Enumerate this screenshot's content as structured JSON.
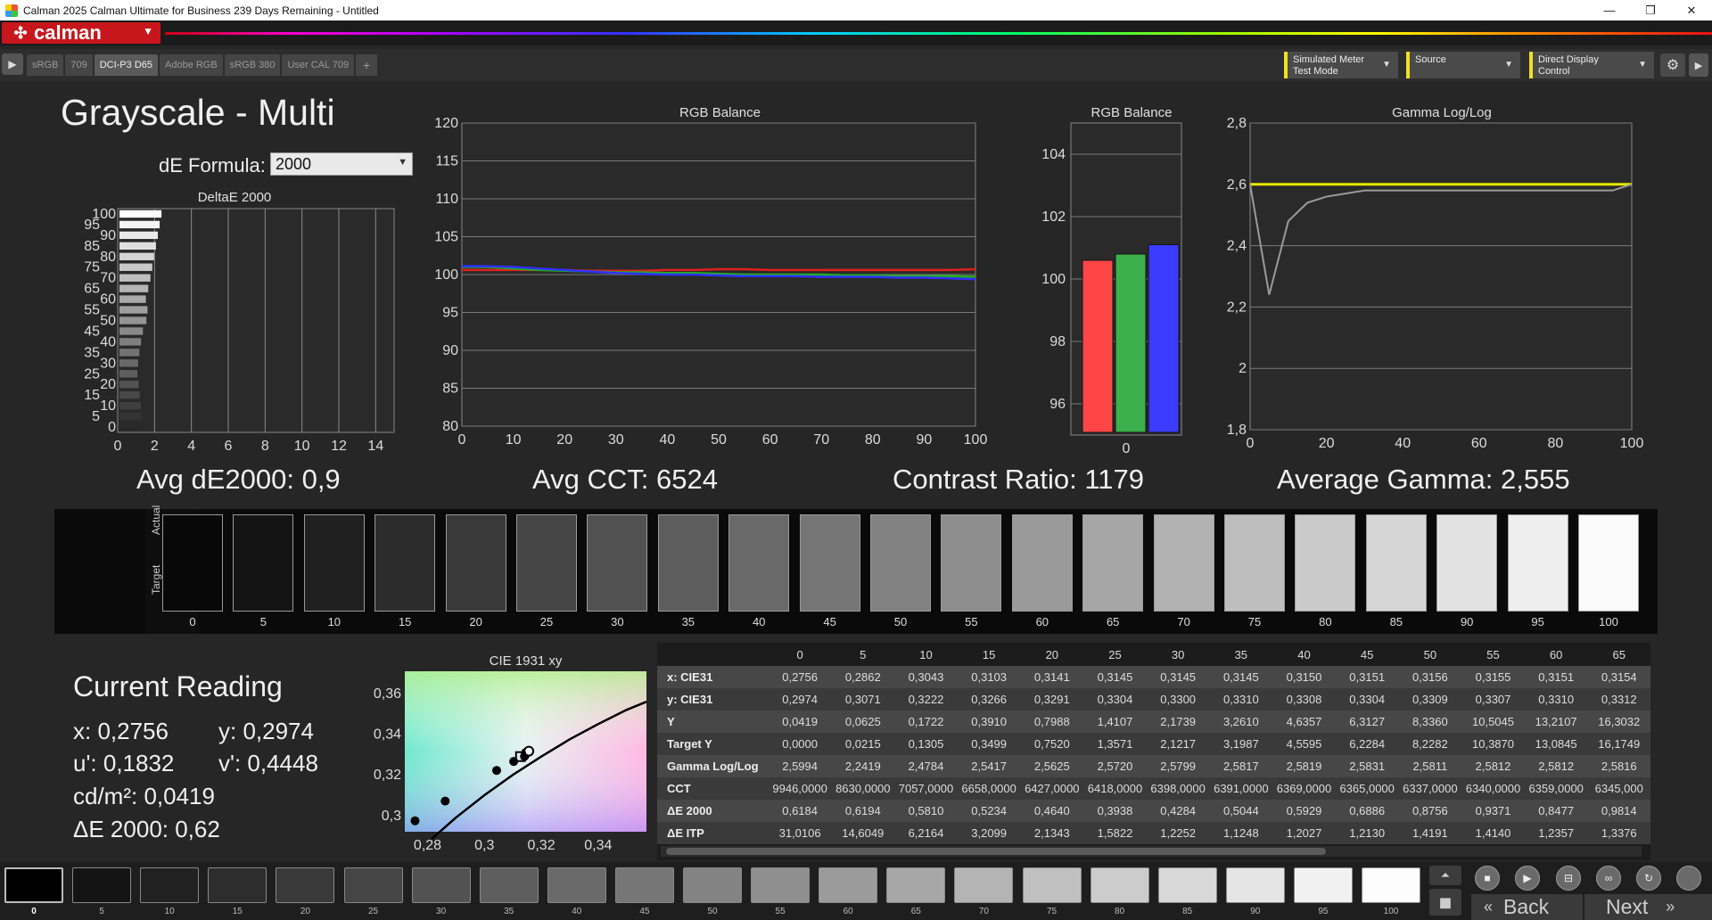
{
  "window": {
    "title": "Calman 2025 Calman Ultimate for Business 239 Days Remaining  - Untitled",
    "minimize": "—",
    "maximize": "❐",
    "close": "✕"
  },
  "brand": {
    "logo_text": "calman",
    "accent": "#c8161d"
  },
  "tabs": [
    {
      "label": "sRGB"
    },
    {
      "label": "709"
    },
    {
      "label": "DCI-P3 D65",
      "active": true
    },
    {
      "label": "Adobe RGB"
    },
    {
      "label": "sRGB 380"
    },
    {
      "label": "User CAL 709"
    },
    {
      "label": "+"
    }
  ],
  "devices": {
    "meter": {
      "line1": "Simulated Meter",
      "line2": "Test Mode"
    },
    "source": {
      "line1": "Source"
    },
    "display": {
      "line1": "Direct Display Control"
    }
  },
  "page_title": "Grayscale - Multi",
  "de_formula": {
    "label": "dE Formula:",
    "value": "2000"
  },
  "stats": {
    "avg_de": "Avg dE2000: 0,9",
    "avg_cct": "Avg CCT: 6524",
    "contrast": "Contrast Ratio: 1179",
    "avg_gamma": "Average Gamma: 2,555"
  },
  "swatch_strip": {
    "actual_label": "Actual",
    "target_label": "Target",
    "levels": [
      "0",
      "5",
      "10",
      "15",
      "20",
      "25",
      "30",
      "35",
      "40",
      "45",
      "50",
      "55",
      "60",
      "65",
      "70",
      "75",
      "80",
      "85",
      "90",
      "95",
      "100"
    ]
  },
  "current_reading": {
    "title": "Current Reading",
    "x": "x: 0,2756",
    "y": "y: 0,2974",
    "u": "u': 0,1832",
    "v": "v': 0,4448",
    "cd": "cd/m²: 0,0419",
    "de": "ΔE 2000: 0,62"
  },
  "table": {
    "columns": [
      "0",
      "5",
      "10",
      "15",
      "20",
      "25",
      "30",
      "35",
      "40",
      "45",
      "50",
      "55",
      "60",
      "65"
    ],
    "rows": [
      {
        "label": "x: CIE31",
        "values": [
          "0,2756",
          "0,2862",
          "0,3043",
          "0,3103",
          "0,3141",
          "0,3145",
          "0,3145",
          "0,3145",
          "0,3150",
          "0,3151",
          "0,3156",
          "0,3155",
          "0,3151",
          "0,3154"
        ]
      },
      {
        "label": "y: CIE31",
        "values": [
          "0,2974",
          "0,3071",
          "0,3222",
          "0,3266",
          "0,3291",
          "0,3304",
          "0,3300",
          "0,3310",
          "0,3308",
          "0,3304",
          "0,3309",
          "0,3307",
          "0,3310",
          "0,3312"
        ]
      },
      {
        "label": "Y",
        "values": [
          "0,0419",
          "0,0625",
          "0,1722",
          "0,3910",
          "0,7988",
          "1,4107",
          "2,1739",
          "3,2610",
          "4,6357",
          "6,3127",
          "8,3360",
          "10,5045",
          "13,2107",
          "16,3032"
        ]
      },
      {
        "label": "Target Y",
        "values": [
          "0,0000",
          "0,0215",
          "0,1305",
          "0,3499",
          "0,7520",
          "1,3571",
          "2,1217",
          "3,1987",
          "4,5595",
          "6,2284",
          "8,2282",
          "10,3870",
          "13,0845",
          "16,1749"
        ]
      },
      {
        "label": "Gamma Log/Log",
        "values": [
          "2,5994",
          "2,2419",
          "2,4784",
          "2,5417",
          "2,5625",
          "2,5720",
          "2,5799",
          "2,5817",
          "2,5819",
          "2,5831",
          "2,5811",
          "2,5812",
          "2,5812",
          "2,5816"
        ]
      },
      {
        "label": "CCT",
        "values": [
          "9946,0000",
          "8630,0000",
          "7057,0000",
          "6658,0000",
          "6427,0000",
          "6418,0000",
          "6398,0000",
          "6391,0000",
          "6369,0000",
          "6365,0000",
          "6337,0000",
          "6340,0000",
          "6359,0000",
          "6345,000"
        ]
      },
      {
        "label": "ΔE 2000",
        "values": [
          "0,6184",
          "0,6194",
          "0,5810",
          "0,5234",
          "0,4640",
          "0,3938",
          "0,4284",
          "0,5044",
          "0,5929",
          "0,6886",
          "0,8756",
          "0,9371",
          "0,8477",
          "0,9814"
        ]
      },
      {
        "label": "ΔE ITP",
        "values": [
          "31,0106",
          "14,6049",
          "6,2164",
          "3,2099",
          "2,1343",
          "1,5822",
          "1,2252",
          "1,1248",
          "1,2027",
          "1,2130",
          "1,4191",
          "1,4140",
          "1,2357",
          "1,3376"
        ]
      }
    ]
  },
  "bottom": {
    "levels": [
      "0",
      "5",
      "10",
      "15",
      "20",
      "25",
      "30",
      "35",
      "40",
      "45",
      "50",
      "55",
      "60",
      "65",
      "70",
      "75",
      "80",
      "85",
      "90",
      "95",
      "100"
    ],
    "back_label": "Back",
    "next_label": "Next"
  },
  "chart_data": [
    {
      "type": "bar",
      "title": "DeltaE 2000",
      "orientation": "horizontal",
      "categories": [
        "0",
        "5",
        "10",
        "15",
        "20",
        "25",
        "30",
        "35",
        "40",
        "45",
        "50",
        "55",
        "60",
        "65",
        "70",
        "75",
        "80",
        "85",
        "90",
        "95",
        "100"
      ],
      "values": [
        0.62,
        0.62,
        0.58,
        0.52,
        0.46,
        0.39,
        0.43,
        0.5,
        0.59,
        0.69,
        0.88,
        0.94,
        0.85,
        0.98,
        1.1,
        1.2,
        1.3,
        1.4,
        1.5,
        1.6,
        1.7
      ],
      "xlim": [
        0,
        15
      ],
      "x_ticks": [
        "0",
        "2",
        "4",
        "6",
        "8",
        "10",
        "12",
        "14"
      ],
      "y_ticks": [
        "0",
        "5",
        "10",
        "15",
        "20",
        "25",
        "30",
        "35",
        "40",
        "45",
        "50",
        "55",
        "60",
        "65",
        "70",
        "75",
        "80",
        "85",
        "90",
        "95",
        "100"
      ]
    },
    {
      "type": "line",
      "title": "RGB Balance",
      "x": [
        0,
        5,
        10,
        15,
        20,
        25,
        30,
        35,
        40,
        45,
        50,
        55,
        60,
        65,
        70,
        75,
        80,
        85,
        90,
        95,
        100
      ],
      "series": [
        {
          "color": "#e02020",
          "values": [
            100.6,
            100.6,
            100.6,
            100.6,
            100.6,
            100.5,
            100.5,
            100.5,
            100.6,
            100.6,
            100.7,
            100.7,
            100.6,
            100.6,
            100.6,
            100.6,
            100.6,
            100.6,
            100.6,
            100.6,
            100.7
          ]
        },
        {
          "color": "#20b020",
          "values": [
            101.0,
            101.0,
            100.8,
            100.6,
            100.5,
            100.4,
            100.3,
            100.3,
            100.2,
            100.2,
            100.1,
            100.0,
            100.0,
            100.0,
            100.0,
            99.9,
            99.9,
            99.8,
            99.8,
            99.8,
            99.7
          ]
        },
        {
          "color": "#3030ff",
          "values": [
            101.1,
            101.1,
            101.0,
            100.8,
            100.6,
            100.4,
            100.2,
            100.1,
            100.0,
            100.0,
            99.9,
            99.8,
            99.8,
            99.8,
            99.7,
            99.7,
            99.7,
            99.6,
            99.6,
            99.5,
            99.4
          ]
        }
      ],
      "ylim": [
        80,
        120
      ],
      "y_ticks": [
        80,
        85,
        90,
        95,
        100,
        105,
        110,
        115,
        120
      ],
      "x_ticks": [
        0,
        10,
        20,
        30,
        40,
        50,
        60,
        70,
        80,
        90,
        100
      ]
    },
    {
      "type": "bar",
      "title": "RGB Balance",
      "categories": [
        "0"
      ],
      "series": [
        {
          "color": "#ff4646",
          "values": [
            100.6
          ]
        },
        {
          "color": "#3cb04a",
          "values": [
            100.8
          ]
        },
        {
          "color": "#3c3cff",
          "values": [
            101.1
          ]
        }
      ],
      "ylim": [
        95,
        105
      ],
      "y_ticks": [
        96,
        98,
        100,
        102,
        104
      ]
    },
    {
      "type": "line",
      "title": "Gamma Log/Log",
      "x": [
        0,
        5,
        10,
        15,
        20,
        25,
        30,
        35,
        40,
        45,
        50,
        55,
        60,
        65,
        70,
        75,
        80,
        85,
        90,
        95,
        100
      ],
      "series": [
        {
          "color": "#e8e800",
          "values": [
            2.6,
            2.6,
            2.6,
            2.6,
            2.6,
            2.6,
            2.6,
            2.6,
            2.6,
            2.6,
            2.6,
            2.6,
            2.6,
            2.6,
            2.6,
            2.6,
            2.6,
            2.6,
            2.6,
            2.6,
            2.6
          ]
        },
        {
          "color": "#9a9a9a",
          "values": [
            2.6,
            2.24,
            2.48,
            2.54,
            2.56,
            2.57,
            2.58,
            2.58,
            2.58,
            2.58,
            2.58,
            2.58,
            2.58,
            2.58,
            2.58,
            2.58,
            2.58,
            2.58,
            2.58,
            2.58,
            2.6
          ]
        }
      ],
      "ylim": [
        1.8,
        2.8
      ],
      "y_ticks": [
        "1,8",
        "2",
        "2,2",
        "2,4",
        "2,6",
        "2,8"
      ],
      "x_ticks": [
        0,
        20,
        40,
        60,
        80,
        100
      ]
    },
    {
      "type": "scatter",
      "title": "CIE 1931 xy",
      "points_x": [
        0.2756,
        0.2862,
        0.3043,
        0.3103,
        0.3141,
        0.3145,
        0.3145,
        0.3145,
        0.315
      ],
      "points_y": [
        0.2974,
        0.3071,
        0.3222,
        0.3266,
        0.3291,
        0.3304,
        0.33,
        0.331,
        0.3308
      ],
      "target": [
        0.3127,
        0.329
      ],
      "xlim": [
        0.272,
        0.357
      ],
      "ylim": [
        0.292,
        0.371
      ],
      "x_ticks": [
        "0,28",
        "0,3",
        "0,32",
        "0,34"
      ],
      "y_ticks": [
        "0,3",
        "0,32",
        "0,34",
        "0,36"
      ]
    }
  ]
}
